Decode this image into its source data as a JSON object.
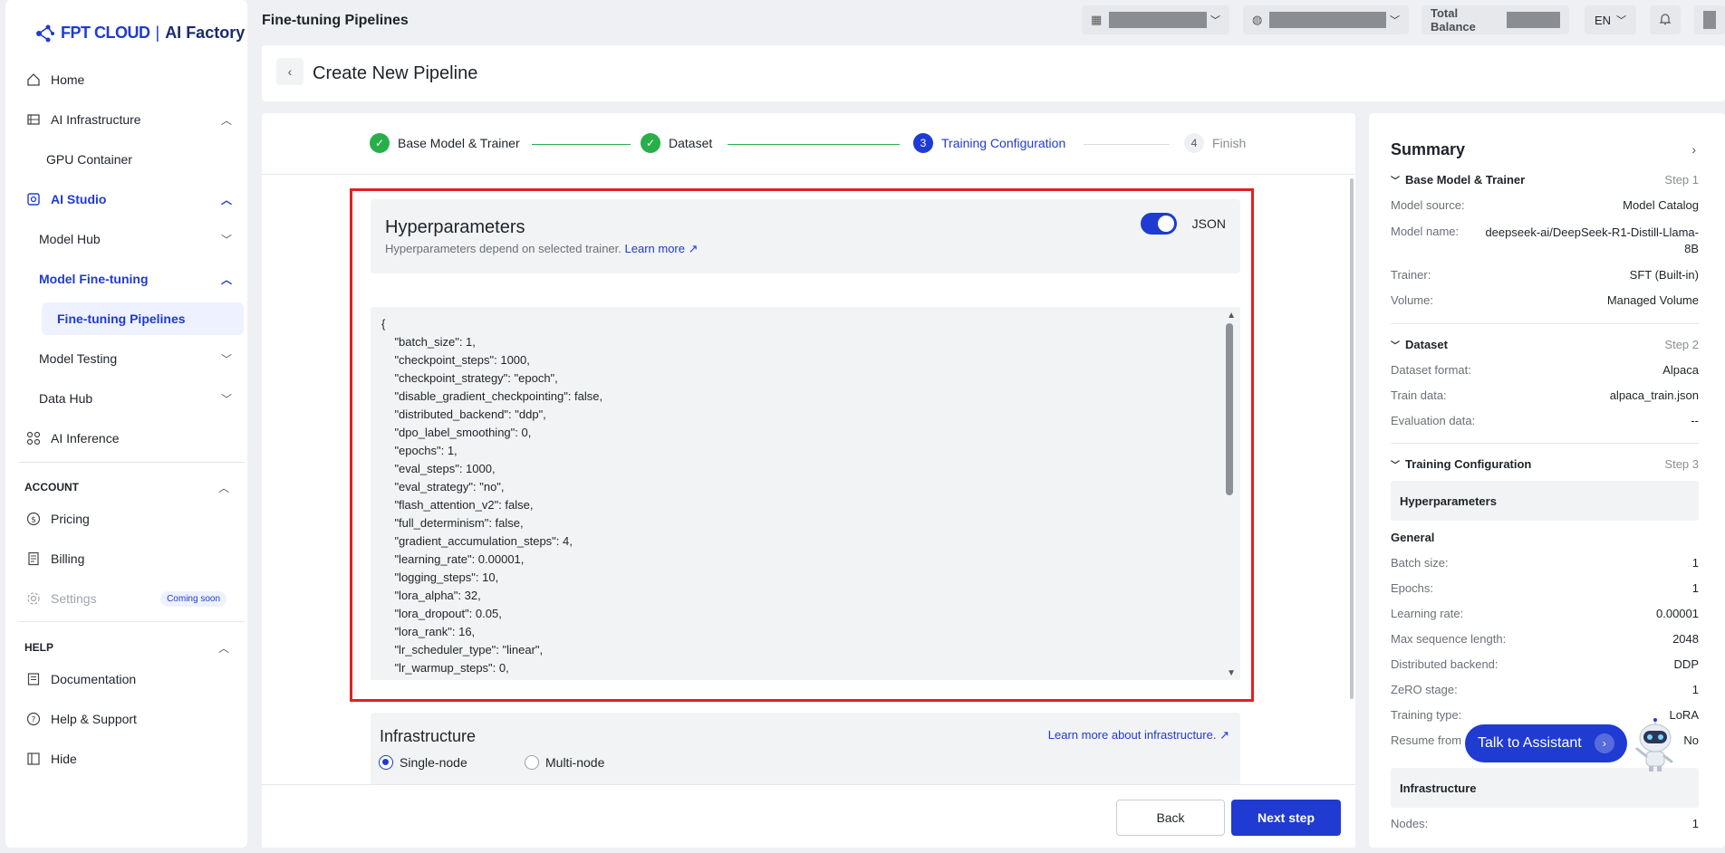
{
  "brand": {
    "logo_main": "FPT CLOUD",
    "logo_product": "AI Factory"
  },
  "sidebar": {
    "items": [
      {
        "label": "Home",
        "icon": "home-icon"
      },
      {
        "label": "AI Infrastructure",
        "icon": "server-icon"
      },
      {
        "label": "GPU Container"
      },
      {
        "label": "AI Studio",
        "icon": "studio-icon"
      },
      {
        "label": "Model Hub"
      },
      {
        "label": "Model Fine-tuning"
      },
      {
        "label": "Fine-tuning Pipelines"
      },
      {
        "label": "Model Testing"
      },
      {
        "label": "Data Hub"
      },
      {
        "label": "AI Inference",
        "icon": "grid-icon"
      }
    ],
    "account_label": "ACCOUNT",
    "account_items": [
      {
        "label": "Pricing",
        "icon": "dollar-icon"
      },
      {
        "label": "Billing",
        "icon": "receipt-icon"
      },
      {
        "label": "Settings",
        "icon": "gear-icon",
        "badge": "Coming soon"
      }
    ],
    "help_label": "HELP",
    "help_items": [
      {
        "label": "Documentation",
        "icon": "document-icon"
      },
      {
        "label": "Help & Support",
        "icon": "question-icon"
      },
      {
        "label": "Hide",
        "icon": "hide-icon"
      }
    ]
  },
  "topbar": {
    "page_title": "Fine-tuning Pipelines",
    "balance_label": "Total Balance",
    "language": "EN"
  },
  "header": {
    "title": "Create New Pipeline"
  },
  "stepper": {
    "steps": [
      {
        "label": "Base Model & Trainer",
        "state": "done"
      },
      {
        "label": "Dataset",
        "state": "done"
      },
      {
        "number": "3",
        "label": "Training Configuration",
        "state": "active"
      },
      {
        "number": "4",
        "label": "Finish",
        "state": "todo"
      }
    ]
  },
  "hyperparameters": {
    "title": "Hyperparameters",
    "subtitle": "Hyperparameters depend on selected trainer.",
    "learn_more": "Learn more",
    "toggle_label": "JSON",
    "json_lines": [
      "{",
      "    \"batch_size\": 1,",
      "    \"checkpoint_steps\": 1000,",
      "    \"checkpoint_strategy\": \"epoch\",",
      "    \"disable_gradient_checkpointing\": false,",
      "    \"distributed_backend\": \"ddp\",",
      "    \"dpo_label_smoothing\": 0,",
      "    \"epochs\": 1,",
      "    \"eval_steps\": 1000,",
      "    \"eval_strategy\": \"no\",",
      "    \"flash_attention_v2\": false,",
      "    \"full_determinism\": false,",
      "    \"gradient_accumulation_steps\": 4,",
      "    \"learning_rate\": 0.00001,",
      "    \"logging_steps\": 10,",
      "    \"lora_alpha\": 32,",
      "    \"lora_dropout\": 0.05,",
      "    \"lora_rank\": 16,",
      "    \"lr_scheduler_type\": \"linear\",",
      "    \"lr_warmup_steps\": 0,"
    ]
  },
  "infrastructure": {
    "title": "Infrastructure",
    "learn_more": "Learn more about infrastructure.",
    "options": [
      "Single-node",
      "Multi-node"
    ],
    "selected": "Single-node"
  },
  "footer": {
    "back_label": "Back",
    "next_label": "Next step"
  },
  "summary": {
    "title": "Summary",
    "sections": [
      {
        "title": "Base Model & Trainer",
        "step": "Step 1",
        "rows": [
          {
            "k": "Model source:",
            "v": "Model Catalog"
          },
          {
            "k": "Model name:",
            "v": "deepseek-ai/DeepSeek-R1-Distill-Llama-8B"
          },
          {
            "k": "Trainer:",
            "v": "SFT (Built-in)"
          },
          {
            "k": "Volume:",
            "v": "Managed Volume"
          }
        ]
      },
      {
        "title": "Dataset",
        "step": "Step 2",
        "rows": [
          {
            "k": "Dataset format:",
            "v": "Alpaca"
          },
          {
            "k": "Train data:",
            "v": "alpaca_train.json"
          },
          {
            "k": "Evaluation data:",
            "v": "--"
          }
        ]
      },
      {
        "title": "Training Configuration",
        "step": "Step 3"
      }
    ],
    "hyper_block": "Hyperparameters",
    "general_label": "General",
    "general_rows": [
      {
        "k": "Batch size:",
        "v": "1"
      },
      {
        "k": "Epochs:",
        "v": "1"
      },
      {
        "k": "Learning rate:",
        "v": "0.00001"
      },
      {
        "k": "Max sequence length:",
        "v": "2048"
      },
      {
        "k": "Distributed backend:",
        "v": "DDP"
      },
      {
        "k": "ZeRO stage:",
        "v": "1"
      },
      {
        "k": "Training type:",
        "v": "LoRA"
      },
      {
        "k": "Resume from",
        "v": "No"
      }
    ],
    "infra_block": "Infrastructure",
    "nodes_label": "Nodes:",
    "nodes_value": "1"
  },
  "assistant": {
    "label": "Talk to Assistant"
  }
}
